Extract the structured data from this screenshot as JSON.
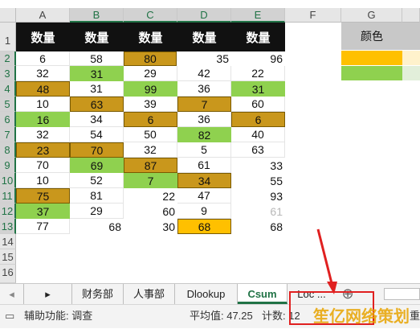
{
  "columns": [
    "A",
    "B",
    "C",
    "D",
    "E",
    "F",
    "G"
  ],
  "rows": [
    "1",
    "2",
    "3",
    "4",
    "5",
    "6",
    "7",
    "8",
    "9",
    "10",
    "11",
    "12",
    "13",
    "14",
    "15",
    "16"
  ],
  "header_label": "数量",
  "color_header_label": "颜色",
  "cells": {
    "row2": [
      "6",
      "58",
      "80",
      "35",
      "96"
    ],
    "row3": [
      "32",
      "31",
      "29",
      "42",
      "22"
    ],
    "row4": [
      "48",
      "31",
      "99",
      "36",
      "31"
    ],
    "row5": [
      "10",
      "63",
      "39",
      "7",
      "60"
    ],
    "row6": [
      "16",
      "34",
      "6",
      "36",
      "6"
    ],
    "row7": [
      "32",
      "54",
      "50",
      "82",
      "40"
    ],
    "row8": [
      "23",
      "70",
      "32",
      "5",
      "63"
    ],
    "row9": [
      "70",
      "69",
      "87",
      "61",
      "33"
    ],
    "row10": [
      "10",
      "52",
      "7",
      "34",
      "55"
    ],
    "row11": [
      "75",
      "81",
      "22",
      "47",
      "93"
    ],
    "row12": [
      "37",
      "29",
      "60",
      "9",
      "61"
    ],
    "row13": [
      "77",
      "68",
      "30",
      "68",
      "68"
    ]
  },
  "colors": {
    "gold": "#c9971c",
    "green": "#8fd14f",
    "yellow": "#ffc000",
    "excel_green": "#217346",
    "annotation_red": "#e02020"
  },
  "tabs": {
    "prev_icon": "◂",
    "next_icon": "▸",
    "items": [
      "财务部",
      "人事部",
      "Dlookup",
      "Csum",
      "Loc ..."
    ],
    "add_icon": "⊕"
  },
  "status": {
    "accessibility": "辅助功能: 调查",
    "average": "平均值: 47.25",
    "count": "计数: 12",
    "right_text": "重"
  },
  "watermark": "笙亿网络策划"
}
